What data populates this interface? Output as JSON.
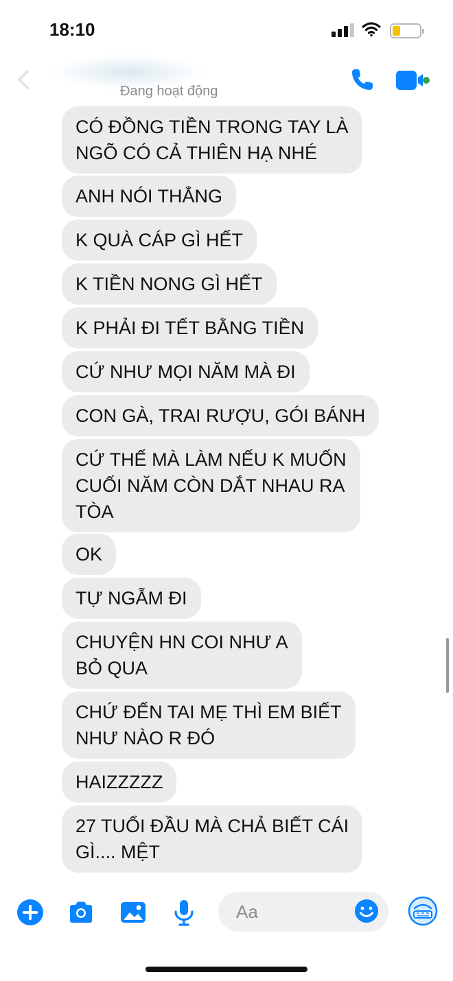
{
  "status_bar": {
    "time": "18:10"
  },
  "header": {
    "presence": "Đang hoạt động"
  },
  "messages": [
    {
      "text": "CÓ ĐỒNG TIỀN TRONG TAY LÀ\nNGÕ CÓ CẢ THIÊN HẠ NHÉ"
    },
    {
      "text": "ANH NÓI THẲNG"
    },
    {
      "text": "K QUÀ CÁP GÌ HẾT"
    },
    {
      "text": "K TIỀN NONG GÌ HẾT"
    },
    {
      "text": "K PHẢI ĐI TẾT BẰNG TIỀN"
    },
    {
      "text": "CỨ NHƯ MỌI NĂM MÀ ĐI"
    },
    {
      "text": "CON GÀ, TRAI RƯỢU, GÓI BÁNH"
    },
    {
      "text": "CỨ THẾ MÀ LÀM NẾU K MUỐN\nCUỐI NĂM CÒN DẮT NHAU RA\nTÒA"
    },
    {
      "text": "OK"
    },
    {
      "text": "TỰ NGẪM ĐI"
    },
    {
      "text": "CHUYỆN HN COI NHƯ A\nBỎ QUA"
    },
    {
      "text": "CHỨ ĐẾN TAI MẸ THÌ EM BIẾT\nNHƯ NÀO R ĐÓ"
    },
    {
      "text": "HAIZZZZZ"
    },
    {
      "text": "27 TUỔI ĐẦU MÀ CHẢ BIẾT CÁI\nGÌ.... MỆT"
    }
  ],
  "composer": {
    "placeholder": "Aa"
  },
  "icons": {
    "back": "chevron-left-icon",
    "call": "phone-icon",
    "video": "video-camera-icon",
    "more": "plus-circle-icon",
    "camera": "camera-icon",
    "gallery": "image-icon",
    "voice": "microphone-icon",
    "emoji": "smiley-icon",
    "quick_reaction": "custom-sticker-icon"
  },
  "colors": {
    "accent": "#0a84ff",
    "bubble": "#ebebed",
    "online": "#31a24c",
    "battery": "#f4c300"
  }
}
